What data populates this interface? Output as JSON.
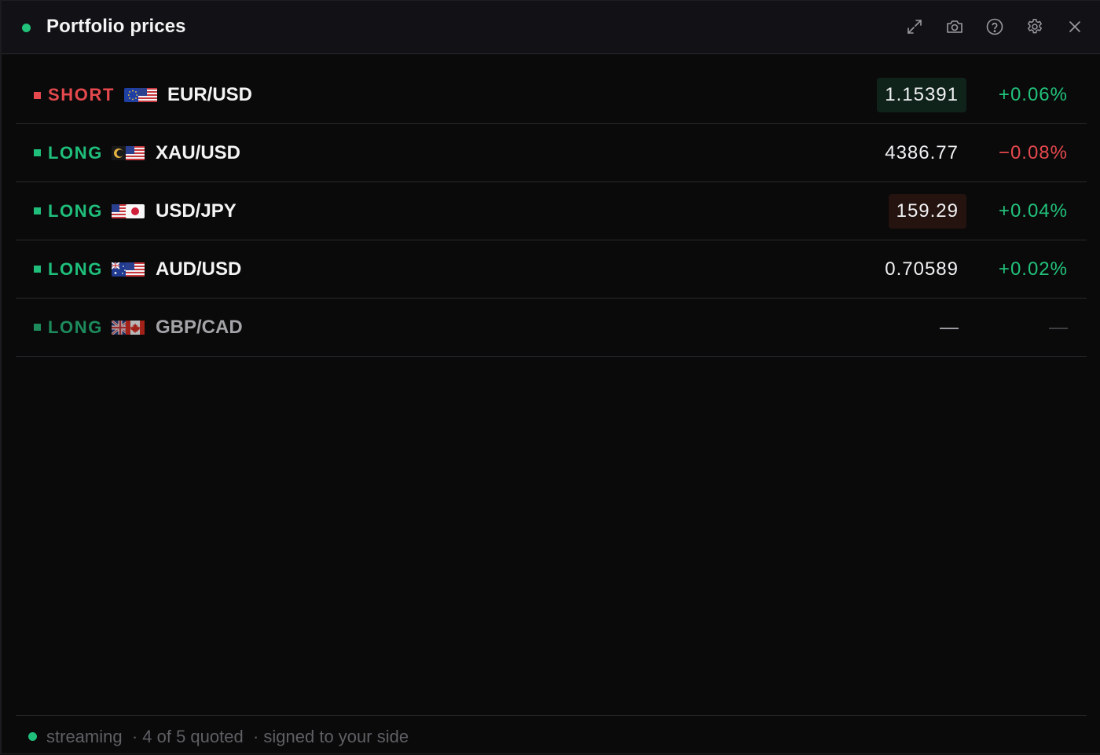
{
  "header": {
    "title": "Portfolio prices",
    "status_color": "#22c27a",
    "icons": [
      "expand-icon",
      "camera-icon",
      "help-icon",
      "settings-icon",
      "close-icon"
    ]
  },
  "rows": [
    {
      "side": "SHORT",
      "pair": "EUR/USD",
      "flags": [
        "eu",
        "us"
      ],
      "price": "1.15391",
      "price_flash": "up",
      "change": "+0.06%",
      "change_dir": "pos"
    },
    {
      "side": "LONG",
      "pair": "XAU/USD",
      "flags": [
        "xau",
        "us"
      ],
      "price": "4386.77",
      "price_flash": "none",
      "change": "−0.08%",
      "change_dir": "neg"
    },
    {
      "side": "LONG",
      "pair": "USD/JPY",
      "flags": [
        "us",
        "jp"
      ],
      "price": "159.29",
      "price_flash": "down",
      "change": "+0.04%",
      "change_dir": "pos"
    },
    {
      "side": "LONG",
      "pair": "AUD/USD",
      "flags": [
        "au",
        "us"
      ],
      "price": "0.70589",
      "price_flash": "none",
      "change": "+0.02%",
      "change_dir": "pos"
    },
    {
      "side": "LONG",
      "pair": "GBP/CAD",
      "flags": [
        "gb",
        "ca"
      ],
      "price": "—",
      "price_flash": "none",
      "change": "—",
      "change_dir": "none",
      "stale": true
    }
  ],
  "footer": {
    "status": "streaming",
    "quoted": "· 4 of 5 quoted",
    "note": "· signed to your side"
  },
  "colors": {
    "short": "#e5484d",
    "long": "#1fbf7b",
    "positive": "#22c27a",
    "negative": "#e5484d"
  }
}
